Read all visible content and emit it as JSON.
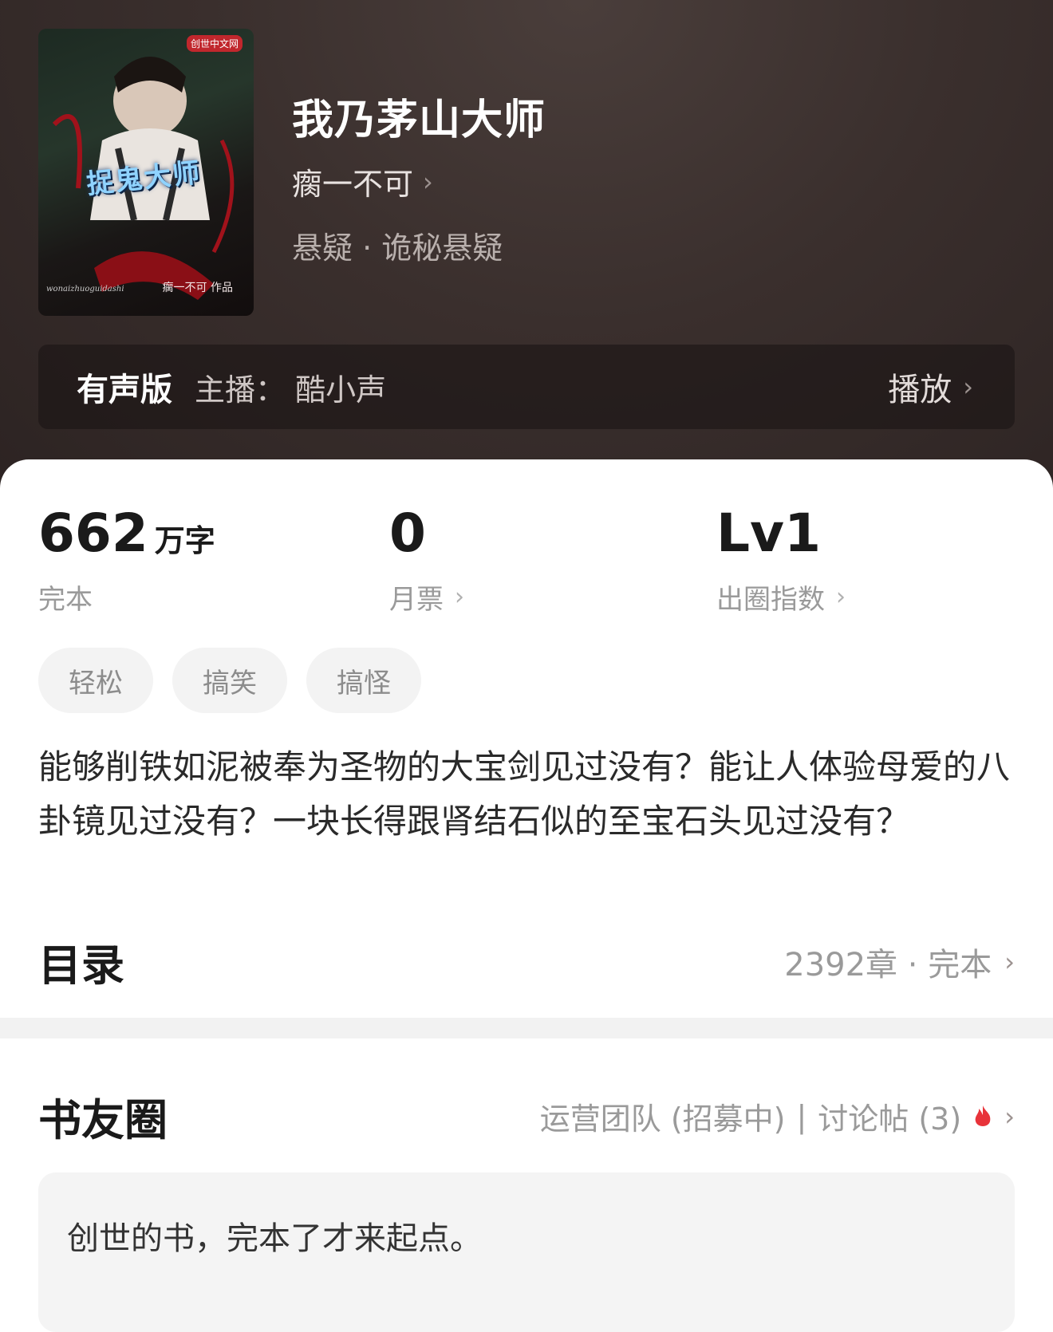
{
  "book": {
    "title": "我乃茅山大师",
    "author": "瘸一不可",
    "genre": "悬疑 · 诡秘悬疑",
    "cover": {
      "title_art": "捉鬼大师",
      "author_art": "瘸一不可 作品",
      "pinyin": "wonaizhuoguidashi",
      "logo": "创世中文网"
    }
  },
  "audio": {
    "label": "有声版",
    "host": "主播： 酷小声",
    "play": "播放"
  },
  "stats": {
    "words_value": "662",
    "words_unit": "万字",
    "words_label": "完本",
    "tickets_value": "0",
    "tickets_label": "月票",
    "level_value": "Lv1",
    "level_label": "出圈指数"
  },
  "tags": [
    "轻松",
    "搞笑",
    "搞怪"
  ],
  "description": "能够削铁如泥被奉为圣物的大宝剑见过没有？能让人体验母爱的八卦镜见过没有？一块长得跟肾结石似的至宝石头见过没有？",
  "toc": {
    "title": "目录",
    "info": "2392章 · 完本"
  },
  "circle": {
    "title": "书友圈",
    "team": "运营团队 (招募中)",
    "separator": "|",
    "posts": "讨论帖 (3)"
  },
  "post": {
    "text": "创世的书，完本了才来起点。"
  },
  "colors": {
    "header_bg": "#3a2f2d",
    "flame": "#e8333a"
  }
}
